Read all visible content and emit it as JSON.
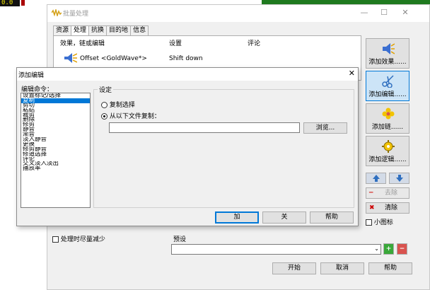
{
  "background": {
    "counter": "0.0"
  },
  "window": {
    "title": "批量处理",
    "tabs": [
      "资源",
      "处理",
      "抗换",
      "目的地",
      "信息"
    ],
    "active_tab": 1,
    "list": {
      "headers": [
        "效果，链或编辑",
        "设置",
        "评论"
      ],
      "rows": [
        {
          "effect": "Offset <GoldWave*>",
          "setting": "Shift down",
          "comment": ""
        }
      ]
    },
    "side_buttons": [
      "添加效果......",
      "添加编辑......",
      "添加链......",
      "添加逻辑......"
    ],
    "remove_label": "去除",
    "clear_label": "清除",
    "small_icons_label": "小图标",
    "reduce_label": "处理时尽量减少",
    "preset_label": "预设",
    "preset_value": "",
    "start_label": "开始",
    "cancel_label": "取消",
    "help_label": "帮助"
  },
  "dialog": {
    "title": "添加编辑",
    "commands_label": "编辑命令：",
    "commands": [
      "设置标记/选择",
      "复制",
      "剪切",
      "粘贴",
      "裁剪",
      "删除",
      "修剪",
      "静音",
      "渐音",
      "淡入静音",
      "更换",
      "修剪静音",
      "修道选择",
      "评论",
      "交叉淡入淡出",
      "播放率"
    ],
    "selected_command": 1,
    "settings_label": "设定",
    "option_copy_selection": "复制选择",
    "option_copy_from_file": "从以下文件复制：",
    "selected_option": 1,
    "file_path": "",
    "browse_label": "浏览...",
    "add_label": "加",
    "close_label": "关",
    "help_label": "帮助"
  },
  "colors": {
    "accent": "#0078d7",
    "plus_green": "#3aa83a",
    "minus_red": "#d9534f",
    "arrow_blue": "#2f6fbf"
  }
}
